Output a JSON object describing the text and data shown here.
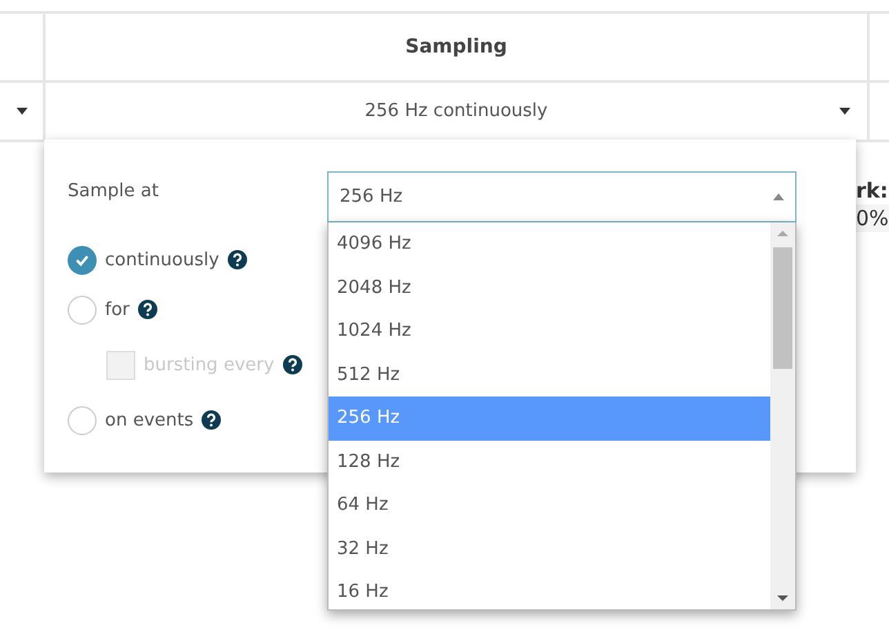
{
  "table": {
    "header": "Sampling",
    "row_value": "256 Hz continuously"
  },
  "background_text": [
    "rk:",
    "0%"
  ],
  "popup": {
    "label": "Sample at",
    "select": {
      "value": "256 Hz",
      "expanded": true
    },
    "options": [
      {
        "label": "4096 Hz",
        "selected": false
      },
      {
        "label": "2048 Hz",
        "selected": false
      },
      {
        "label": "1024 Hz",
        "selected": false
      },
      {
        "label": "512 Hz",
        "selected": false
      },
      {
        "label": "256 Hz",
        "selected": true
      },
      {
        "label": "128 Hz",
        "selected": false
      },
      {
        "label": "64 Hz",
        "selected": false
      },
      {
        "label": "32 Hz",
        "selected": false
      },
      {
        "label": "16 Hz",
        "selected": false
      }
    ],
    "modes": [
      {
        "kind": "radio",
        "label": "continuously",
        "selected": true,
        "disabled": false
      },
      {
        "kind": "radio",
        "label": "for",
        "selected": false,
        "disabled": false
      },
      {
        "kind": "checkbox",
        "label": "bursting every",
        "checked": false,
        "disabled": true
      },
      {
        "kind": "radio",
        "label": "on events",
        "selected": false,
        "disabled": false
      }
    ]
  }
}
